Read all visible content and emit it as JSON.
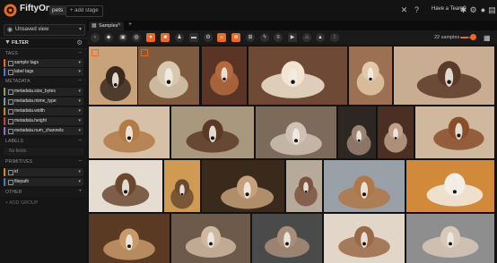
{
  "topbar": {
    "app_name": "FiftyOne",
    "dataset": "pets",
    "add_stage": "+ add stage",
    "team_label": "Have a Team?",
    "icons": [
      "close-icon",
      "help-icon",
      "team-icon",
      "settings-icon",
      "github-icon",
      "docs-icon",
      "theme-icon"
    ]
  },
  "sidebar": {
    "view_select": "Unsaved view",
    "filter_label": "FILTER",
    "sections": {
      "tags": "TAGS",
      "metadata": "METADATA",
      "labels": "LABELS",
      "primitives": "PRIMITIVES",
      "other": "OTHER"
    },
    "tags": [
      {
        "label": "sample tags",
        "color": "#ea6a24"
      },
      {
        "label": "label tags",
        "color": "#4a78d8"
      }
    ],
    "metadata": [
      {
        "label": "metadata.size_bytes",
        "color": "#8a9d5a"
      },
      {
        "label": "metadata.mime_type",
        "color": "#6aa0a8"
      },
      {
        "label": "metadata.width",
        "color": "#c0892f"
      },
      {
        "label": "metadata.height",
        "color": "#c9423a"
      },
      {
        "label": "metadata.num_channels",
        "color": "#9a6cc8"
      }
    ],
    "labels_empty": "No fields",
    "primitives": [
      {
        "label": "id",
        "color": "#d08a2a"
      },
      {
        "label": "filepath",
        "color": "#3f7fd0"
      }
    ],
    "add_group": "+ ADD GROUP"
  },
  "main": {
    "tab_label": "Samples",
    "samples_count": "22 samples",
    "zoom_level": 0.7
  },
  "colors": {
    "accent": "#ea6a24",
    "background": "#0e0e0e",
    "panel": "#151515"
  }
}
